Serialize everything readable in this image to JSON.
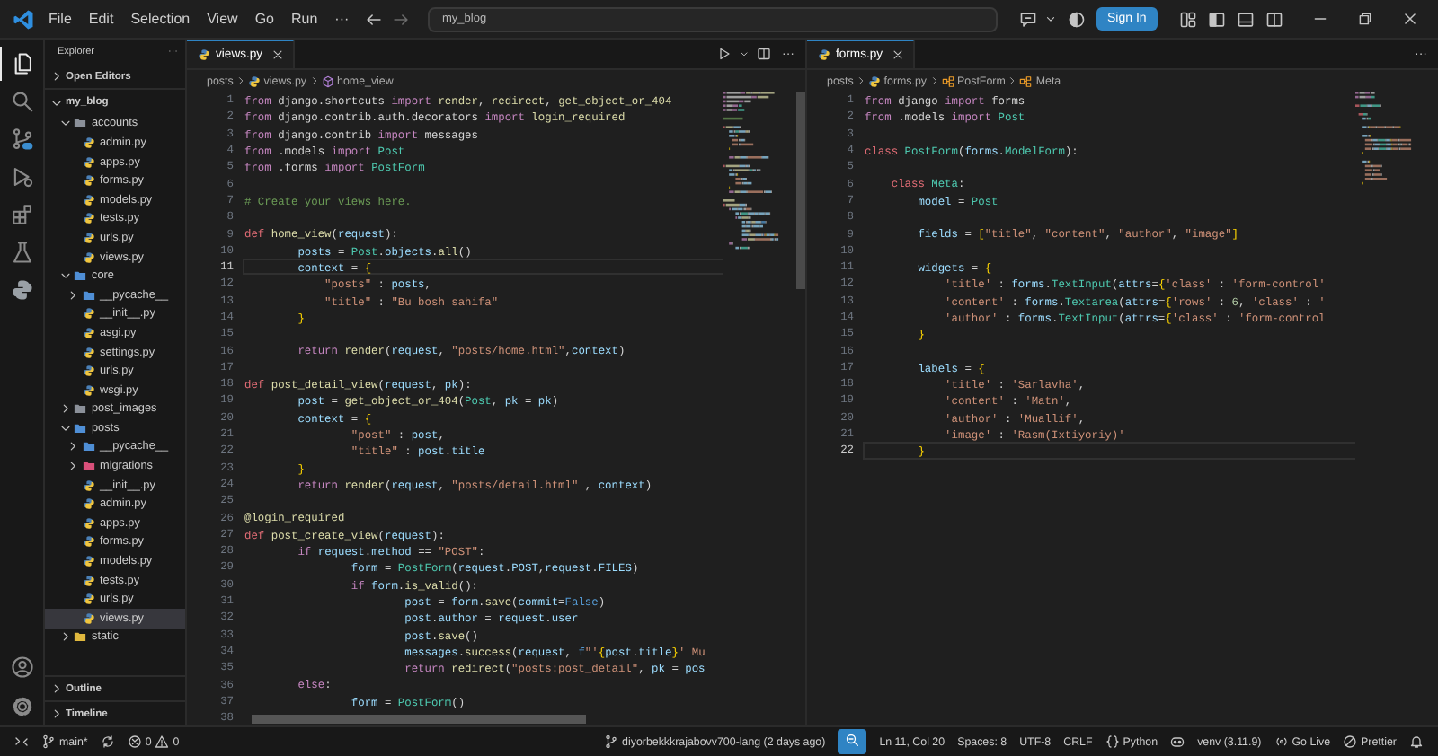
{
  "title_bar": {
    "menus": [
      "File",
      "Edit",
      "Selection",
      "View",
      "Go",
      "Run",
      "···"
    ],
    "search": {
      "value": "my_blog"
    },
    "sign_in": "Sign In"
  },
  "activity_bar": {
    "items": [
      {
        "kind": "files",
        "selected": true
      },
      {
        "kind": "search",
        "selected": false
      },
      {
        "kind": "scm",
        "selected": false
      },
      {
        "kind": "debug",
        "selected": false
      },
      {
        "kind": "extensions",
        "selected": false
      },
      {
        "kind": "flask",
        "selected": false
      },
      {
        "kind": "python",
        "selected": false
      }
    ]
  },
  "sidebar": {
    "title": "Explorer",
    "more": "···",
    "sections": [
      {
        "label": "Open Editors",
        "expanded": false
      }
    ],
    "tree": {
      "label": "my_blog",
      "kind": "root",
      "expanded": true,
      "selected": false,
      "children": [
        {
          "label": "accounts",
          "kind": "folder",
          "color": "#8b9099",
          "expanded": true,
          "selected": false,
          "children": [
            {
              "label": "admin.py",
              "kind": "file",
              "selected": false
            },
            {
              "label": "apps.py",
              "kind": "file",
              "selected": false
            },
            {
              "label": "forms.py",
              "kind": "file",
              "selected": false
            },
            {
              "label": "models.py",
              "kind": "file",
              "selected": false
            },
            {
              "label": "tests.py",
              "kind": "file",
              "selected": false
            },
            {
              "label": "urls.py",
              "kind": "file",
              "selected": false
            },
            {
              "label": "views.py",
              "kind": "file",
              "selected": false
            }
          ]
        },
        {
          "label": "core",
          "kind": "folder",
          "color": "#4f8fd6",
          "expanded": true,
          "selected": false,
          "children": [
            {
              "label": "__pycache__",
              "kind": "folder",
              "color": "#4f8fd6",
              "expanded": false,
              "selected": false
            },
            {
              "label": "__init__.py",
              "kind": "file",
              "selected": false
            },
            {
              "label": "asgi.py",
              "kind": "file",
              "selected": false
            },
            {
              "label": "settings.py",
              "kind": "file",
              "selected": false
            },
            {
              "label": "urls.py",
              "kind": "file",
              "selected": false
            },
            {
              "label": "wsgi.py",
              "kind": "file",
              "selected": false
            }
          ]
        },
        {
          "label": "post_images",
          "kind": "folder",
          "color": "#8b9099",
          "expanded": false,
          "selected": false
        },
        {
          "label": "posts",
          "kind": "folder",
          "color": "#4f8fd6",
          "expanded": true,
          "selected": false,
          "children": [
            {
              "label": "__pycache__",
              "kind": "folder",
              "color": "#4f8fd6",
              "expanded": false,
              "selected": false
            },
            {
              "label": "migrations",
              "kind": "folder",
              "color": "#d9507a",
              "expanded": false,
              "selected": false
            },
            {
              "label": "__init__.py",
              "kind": "file",
              "selected": false
            },
            {
              "label": "admin.py",
              "kind": "file",
              "selected": false
            },
            {
              "label": "apps.py",
              "kind": "file",
              "selected": false
            },
            {
              "label": "forms.py",
              "kind": "file",
              "selected": false
            },
            {
              "label": "models.py",
              "kind": "file",
              "selected": false
            },
            {
              "label": "tests.py",
              "kind": "file",
              "selected": false
            },
            {
              "label": "urls.py",
              "kind": "file",
              "selected": false
            },
            {
              "label": "views.py",
              "kind": "file",
              "selected": true
            }
          ]
        },
        {
          "label": "static",
          "kind": "folder",
          "color": "#e0b83e",
          "expanded": false,
          "selected": false
        }
      ]
    },
    "bottom_sections": [
      {
        "label": "Outline",
        "expanded": false
      },
      {
        "label": "Timeline",
        "expanded": false
      }
    ]
  },
  "editors": [
    {
      "tab": {
        "label": "views.py",
        "selected": true
      },
      "actions": [
        {
          "kind": "run"
        },
        {
          "kind": "split"
        }
      ],
      "more": "···",
      "breadcrumb": [
        {
          "label": "posts",
          "kind": "folder"
        },
        {
          "label": "views.py",
          "kind": "file"
        },
        {
          "label": "home_view",
          "kind": "function"
        }
      ],
      "lines": [
        {
          "n": "1",
          "current": false,
          "code": [
            {
              "kind": "kw",
              "text": "from"
            },
            {
              "kind": "plain",
              "text": " django.shortcuts "
            },
            {
              "kind": "kw",
              "text": "import"
            },
            {
              "kind": "fn",
              "text": " render"
            },
            {
              "kind": "plain",
              "text": ", "
            },
            {
              "kind": "fn",
              "text": "redirect"
            },
            {
              "kind": "plain",
              "text": ", "
            },
            {
              "kind": "fn",
              "text": "get_object_or_404"
            }
          ]
        },
        {
          "n": "2",
          "current": false,
          "code": [
            {
              "kind": "kw",
              "text": "from"
            },
            {
              "kind": "plain",
              "text": " django.contrib.auth.decorators "
            },
            {
              "kind": "kw",
              "text": "import"
            },
            {
              "kind": "fn",
              "text": " login_required"
            }
          ]
        },
        {
          "n": "3",
          "current": false,
          "code": [
            {
              "kind": "kw",
              "text": "from"
            },
            {
              "kind": "plain",
              "text": " django.contrib "
            },
            {
              "kind": "kw",
              "text": "import"
            },
            {
              "kind": "plain",
              "text": " messages"
            }
          ]
        },
        {
          "n": "4",
          "current": false,
          "code": [
            {
              "kind": "kw",
              "text": "from"
            },
            {
              "kind": "plain",
              "text": " .models "
            },
            {
              "kind": "kw",
              "text": "import"
            },
            {
              "kind": "type",
              "text": " Post"
            }
          ]
        },
        {
          "n": "5",
          "current": false,
          "code": [
            {
              "kind": "kw",
              "text": "from"
            },
            {
              "kind": "plain",
              "text": " .forms "
            },
            {
              "kind": "kw",
              "text": "import"
            },
            {
              "kind": "type",
              "text": " PostForm"
            }
          ]
        },
        {
          "n": "6",
          "current": false
        },
        {
          "n": "7",
          "current": false,
          "code": [
            {
              "kind": "com",
              "text": "# Create your views here."
            }
          ]
        },
        {
          "n": "8",
          "current": false
        },
        {
          "n": "9",
          "current": false,
          "code": [
            {
              "kind": "def",
              "text": "def"
            },
            {
              "kind": "fn",
              "text": " home_view"
            },
            {
              "kind": "plain",
              "text": "("
            },
            {
              "kind": "var",
              "text": "request"
            },
            {
              "kind": "plain",
              "text": "):"
            }
          ]
        },
        {
          "n": "10",
          "current": false,
          "code": [
            {
              "kind": "var",
              "text": "        posts"
            },
            {
              "kind": "plain",
              "text": " = "
            },
            {
              "kind": "type",
              "text": "Post"
            },
            {
              "kind": "plain",
              "text": "."
            },
            {
              "kind": "var",
              "text": "objects"
            },
            {
              "kind": "plain",
              "text": "."
            },
            {
              "kind": "fn",
              "text": "all"
            },
            {
              "kind": "plain",
              "text": "()"
            }
          ]
        },
        {
          "n": "11",
          "current": true,
          "code": [
            {
              "kind": "var",
              "text": "        context"
            },
            {
              "kind": "plain",
              "text": " = "
            },
            {
              "kind": "brace",
              "text": "{"
            }
          ]
        },
        {
          "n": "12",
          "current": false,
          "code": [
            {
              "kind": "str",
              "text": "            \"posts\""
            },
            {
              "kind": "plain",
              "text": " : "
            },
            {
              "kind": "var",
              "text": "posts"
            },
            {
              "kind": "plain",
              "text": ","
            }
          ]
        },
        {
          "n": "13",
          "current": false,
          "code": [
            {
              "kind": "str",
              "text": "            \"title\""
            },
            {
              "kind": "plain",
              "text": " : "
            },
            {
              "kind": "str",
              "text": "\"Bu bosh sahifa\""
            }
          ]
        },
        {
          "n": "14",
          "current": false,
          "code": [
            {
              "kind": "brace",
              "text": "        }"
            }
          ]
        },
        {
          "n": "15",
          "current": false
        },
        {
          "n": "16",
          "current": false,
          "code": [
            {
              "kind": "kw",
              "text": "        return"
            },
            {
              "kind": "fn",
              "text": " render"
            },
            {
              "kind": "plain",
              "text": "("
            },
            {
              "kind": "var",
              "text": "request"
            },
            {
              "kind": "plain",
              "text": ", "
            },
            {
              "kind": "str",
              "text": "\"posts/home.html\""
            },
            {
              "kind": "plain",
              "text": ","
            },
            {
              "kind": "var",
              "text": "context"
            },
            {
              "kind": "plain",
              "text": ")"
            }
          ]
        },
        {
          "n": "17",
          "current": false
        },
        {
          "n": "18",
          "current": false,
          "code": [
            {
              "kind": "def",
              "text": "def"
            },
            {
              "kind": "fn",
              "text": " post_detail_view"
            },
            {
              "kind": "plain",
              "text": "("
            },
            {
              "kind": "var",
              "text": "request"
            },
            {
              "kind": "plain",
              "text": ", "
            },
            {
              "kind": "var",
              "text": "pk"
            },
            {
              "kind": "plain",
              "text": "):"
            }
          ]
        },
        {
          "n": "19",
          "current": false,
          "code": [
            {
              "kind": "var",
              "text": "        post"
            },
            {
              "kind": "plain",
              "text": " = "
            },
            {
              "kind": "fn",
              "text": "get_object_or_404"
            },
            {
              "kind": "plain",
              "text": "("
            },
            {
              "kind": "type",
              "text": "Post"
            },
            {
              "kind": "plain",
              "text": ", "
            },
            {
              "kind": "var",
              "text": "pk"
            },
            {
              "kind": "plain",
              "text": " = "
            },
            {
              "kind": "var",
              "text": "pk"
            },
            {
              "kind": "plain",
              "text": ")"
            }
          ]
        },
        {
          "n": "20",
          "current": false,
          "code": [
            {
              "kind": "var",
              "text": "        context"
            },
            {
              "kind": "plain",
              "text": " = "
            },
            {
              "kind": "brace",
              "text": "{"
            }
          ]
        },
        {
          "n": "21",
          "current": false,
          "code": [
            {
              "kind": "str",
              "text": "                \"post\""
            },
            {
              "kind": "plain",
              "text": " : "
            },
            {
              "kind": "var",
              "text": "post"
            },
            {
              "kind": "plain",
              "text": ","
            }
          ]
        },
        {
          "n": "22",
          "current": false,
          "code": [
            {
              "kind": "str",
              "text": "                \"title\""
            },
            {
              "kind": "plain",
              "text": " : "
            },
            {
              "kind": "var",
              "text": "post"
            },
            {
              "kind": "plain",
              "text": "."
            },
            {
              "kind": "var",
              "text": "title"
            }
          ]
        },
        {
          "n": "23",
          "current": false,
          "code": [
            {
              "kind": "brace",
              "text": "        }"
            }
          ]
        },
        {
          "n": "24",
          "current": false,
          "code": [
            {
              "kind": "kw",
              "text": "        return"
            },
            {
              "kind": "fn",
              "text": " render"
            },
            {
              "kind": "plain",
              "text": "("
            },
            {
              "kind": "var",
              "text": "request"
            },
            {
              "kind": "plain",
              "text": ", "
            },
            {
              "kind": "str",
              "text": "\"posts/detail.html\""
            },
            {
              "kind": "plain",
              "text": " , "
            },
            {
              "kind": "var",
              "text": "context"
            },
            {
              "kind": "plain",
              "text": ")"
            }
          ]
        },
        {
          "n": "25",
          "current": false
        },
        {
          "n": "26",
          "current": false,
          "code": [
            {
              "kind": "dec",
              "text": "@login_required"
            }
          ]
        },
        {
          "n": "27",
          "current": false,
          "code": [
            {
              "kind": "def",
              "text": "def"
            },
            {
              "kind": "fn",
              "text": " post_create_view"
            },
            {
              "kind": "plain",
              "text": "("
            },
            {
              "kind": "var",
              "text": "request"
            },
            {
              "kind": "plain",
              "text": "):"
            }
          ]
        },
        {
          "n": "28",
          "current": false,
          "code": [
            {
              "kind": "kw",
              "text": "        if"
            },
            {
              "kind": "var",
              "text": " request"
            },
            {
              "kind": "plain",
              "text": "."
            },
            {
              "kind": "var",
              "text": "method"
            },
            {
              "kind": "plain",
              "text": " == "
            },
            {
              "kind": "str",
              "text": "\"POST\""
            },
            {
              "kind": "plain",
              "text": ":"
            }
          ]
        },
        {
          "n": "29",
          "current": false,
          "code": [
            {
              "kind": "var",
              "text": "                form"
            },
            {
              "kind": "plain",
              "text": " = "
            },
            {
              "kind": "type",
              "text": "PostForm"
            },
            {
              "kind": "plain",
              "text": "("
            },
            {
              "kind": "var",
              "text": "request"
            },
            {
              "kind": "plain",
              "text": "."
            },
            {
              "kind": "var",
              "text": "POST"
            },
            {
              "kind": "plain",
              "text": ","
            },
            {
              "kind": "var",
              "text": "request"
            },
            {
              "kind": "plain",
              "text": "."
            },
            {
              "kind": "var",
              "text": "FILES"
            },
            {
              "kind": "plain",
              "text": ")"
            }
          ]
        },
        {
          "n": "30",
          "current": false,
          "code": [
            {
              "kind": "kw",
              "text": "                if"
            },
            {
              "kind": "var",
              "text": " form"
            },
            {
              "kind": "plain",
              "text": "."
            },
            {
              "kind": "fn",
              "text": "is_valid"
            },
            {
              "kind": "plain",
              "text": "():"
            }
          ]
        },
        {
          "n": "31",
          "current": false,
          "code": [
            {
              "kind": "var",
              "text": "                        post"
            },
            {
              "kind": "plain",
              "text": " = "
            },
            {
              "kind": "var",
              "text": "form"
            },
            {
              "kind": "plain",
              "text": "."
            },
            {
              "kind": "fn",
              "text": "save"
            },
            {
              "kind": "plain",
              "text": "("
            },
            {
              "kind": "var",
              "text": "commit"
            },
            {
              "kind": "plain",
              "text": "="
            },
            {
              "kind": "const",
              "text": "False"
            },
            {
              "kind": "plain",
              "text": ")"
            }
          ]
        },
        {
          "n": "32",
          "current": false,
          "code": [
            {
              "kind": "var",
              "text": "                        post"
            },
            {
              "kind": "plain",
              "text": "."
            },
            {
              "kind": "var",
              "text": "author"
            },
            {
              "kind": "plain",
              "text": " = "
            },
            {
              "kind": "var",
              "text": "request"
            },
            {
              "kind": "plain",
              "text": "."
            },
            {
              "kind": "var",
              "text": "user"
            }
          ]
        },
        {
          "n": "33",
          "current": false,
          "code": [
            {
              "kind": "var",
              "text": "                        post"
            },
            {
              "kind": "plain",
              "text": "."
            },
            {
              "kind": "fn",
              "text": "save"
            },
            {
              "kind": "plain",
              "text": "()"
            }
          ]
        },
        {
          "n": "34",
          "current": false,
          "code": [
            {
              "kind": "var",
              "text": "                        messages"
            },
            {
              "kind": "plain",
              "text": "."
            },
            {
              "kind": "fn",
              "text": "success"
            },
            {
              "kind": "plain",
              "text": "("
            },
            {
              "kind": "var",
              "text": "request"
            },
            {
              "kind": "plain",
              "text": ", "
            },
            {
              "kind": "const",
              "text": "f"
            },
            {
              "kind": "str",
              "text": "\"'"
            },
            {
              "kind": "brace",
              "text": "{"
            },
            {
              "kind": "var",
              "text": "post"
            },
            {
              "kind": "plain",
              "text": "."
            },
            {
              "kind": "var",
              "text": "title"
            },
            {
              "kind": "brace",
              "text": "}"
            },
            {
              "kind": "str",
              "text": "' Mu"
            }
          ]
        },
        {
          "n": "35",
          "current": false,
          "code": [
            {
              "kind": "kw",
              "text": "                        return"
            },
            {
              "kind": "fn",
              "text": " redirect"
            },
            {
              "kind": "plain",
              "text": "("
            },
            {
              "kind": "str",
              "text": "\"posts:post_detail\""
            },
            {
              "kind": "plain",
              "text": ", "
            },
            {
              "kind": "var",
              "text": "pk"
            },
            {
              "kind": "plain",
              "text": " = "
            },
            {
              "kind": "var",
              "text": "pos"
            }
          ]
        },
        {
          "n": "36",
          "current": false,
          "code": [
            {
              "kind": "kw",
              "text": "        else"
            },
            {
              "kind": "plain",
              "text": ":"
            }
          ]
        },
        {
          "n": "37",
          "current": false,
          "code": [
            {
              "kind": "var",
              "text": "                form"
            },
            {
              "kind": "plain",
              "text": " = "
            },
            {
              "kind": "type",
              "text": "PostForm"
            },
            {
              "kind": "plain",
              "text": "()"
            }
          ]
        },
        {
          "n": "38",
          "current": false
        }
      ]
    },
    {
      "tab": {
        "label": "forms.py",
        "selected": true
      },
      "more": "···",
      "breadcrumb": [
        {
          "label": "posts",
          "kind": "folder"
        },
        {
          "label": "forms.py",
          "kind": "file"
        },
        {
          "label": "PostForm",
          "kind": "class"
        },
        {
          "label": "Meta",
          "kind": "class"
        }
      ],
      "lines": [
        {
          "n": "1",
          "current": false,
          "code": [
            {
              "kind": "kw",
              "text": "from"
            },
            {
              "kind": "plain",
              "text": " django "
            },
            {
              "kind": "kw",
              "text": "import"
            },
            {
              "kind": "plain",
              "text": " forms"
            }
          ]
        },
        {
          "n": "2",
          "current": false,
          "code": [
            {
              "kind": "kw",
              "text": "from"
            },
            {
              "kind": "plain",
              "text": " .models "
            },
            {
              "kind": "kw",
              "text": "import"
            },
            {
              "kind": "type",
              "text": " Post"
            }
          ]
        },
        {
          "n": "3",
          "current": false
        },
        {
          "n": "4",
          "current": false,
          "code": [
            {
              "kind": "def",
              "text": "class"
            },
            {
              "kind": "type",
              "text": " PostForm"
            },
            {
              "kind": "plain",
              "text": "("
            },
            {
              "kind": "var",
              "text": "forms"
            },
            {
              "kind": "plain",
              "text": "."
            },
            {
              "kind": "type",
              "text": "ModelForm"
            },
            {
              "kind": "plain",
              "text": "):"
            }
          ]
        },
        {
          "n": "5",
          "current": false
        },
        {
          "n": "6",
          "current": false,
          "code": [
            {
              "kind": "def",
              "text": "    class"
            },
            {
              "kind": "type",
              "text": " Meta"
            },
            {
              "kind": "plain",
              "text": ":"
            }
          ]
        },
        {
          "n": "7",
          "current": false,
          "code": [
            {
              "kind": "var",
              "text": "        model"
            },
            {
              "kind": "plain",
              "text": " = "
            },
            {
              "kind": "type",
              "text": "Post"
            }
          ]
        },
        {
          "n": "8",
          "current": false
        },
        {
          "n": "9",
          "current": false,
          "code": [
            {
              "kind": "var",
              "text": "        fields"
            },
            {
              "kind": "plain",
              "text": " = "
            },
            {
              "kind": "brace",
              "text": "["
            },
            {
              "kind": "str",
              "text": "\"title\""
            },
            {
              "kind": "plain",
              "text": ", "
            },
            {
              "kind": "str",
              "text": "\"content\""
            },
            {
              "kind": "plain",
              "text": ", "
            },
            {
              "kind": "str",
              "text": "\"author\""
            },
            {
              "kind": "plain",
              "text": ", "
            },
            {
              "kind": "str",
              "text": "\"image\""
            },
            {
              "kind": "brace",
              "text": "]"
            }
          ]
        },
        {
          "n": "10",
          "current": false
        },
        {
          "n": "11",
          "current": false,
          "code": [
            {
              "kind": "var",
              "text": "        widgets"
            },
            {
              "kind": "plain",
              "text": " = "
            },
            {
              "kind": "brace",
              "text": "{"
            }
          ]
        },
        {
          "n": "12",
          "current": false,
          "code": [
            {
              "kind": "str",
              "text": "            'title'"
            },
            {
              "kind": "plain",
              "text": " : "
            },
            {
              "kind": "var",
              "text": "forms"
            },
            {
              "kind": "plain",
              "text": "."
            },
            {
              "kind": "type",
              "text": "TextInput"
            },
            {
              "kind": "plain",
              "text": "("
            },
            {
              "kind": "var",
              "text": "attrs"
            },
            {
              "kind": "plain",
              "text": "="
            },
            {
              "kind": "brace",
              "text": "{"
            },
            {
              "kind": "str",
              "text": "'class'"
            },
            {
              "kind": "plain",
              "text": " : "
            },
            {
              "kind": "str",
              "text": "'form-control'"
            }
          ]
        },
        {
          "n": "13",
          "current": false,
          "code": [
            {
              "kind": "str",
              "text": "            'content'"
            },
            {
              "kind": "plain",
              "text": " : "
            },
            {
              "kind": "var",
              "text": "forms"
            },
            {
              "kind": "plain",
              "text": "."
            },
            {
              "kind": "type",
              "text": "Textarea"
            },
            {
              "kind": "plain",
              "text": "("
            },
            {
              "kind": "var",
              "text": "attrs"
            },
            {
              "kind": "plain",
              "text": "="
            },
            {
              "kind": "brace",
              "text": "{"
            },
            {
              "kind": "str",
              "text": "'rows'"
            },
            {
              "kind": "plain",
              "text": " : "
            },
            {
              "kind": "num",
              "text": "6"
            },
            {
              "kind": "plain",
              "text": ", "
            },
            {
              "kind": "str",
              "text": "'class'"
            },
            {
              "kind": "plain",
              "text": " : "
            },
            {
              "kind": "str",
              "text": "'"
            }
          ]
        },
        {
          "n": "14",
          "current": false,
          "code": [
            {
              "kind": "str",
              "text": "            'author'"
            },
            {
              "kind": "plain",
              "text": " : "
            },
            {
              "kind": "var",
              "text": "forms"
            },
            {
              "kind": "plain",
              "text": "."
            },
            {
              "kind": "type",
              "text": "TextInput"
            },
            {
              "kind": "plain",
              "text": "("
            },
            {
              "kind": "var",
              "text": "attrs"
            },
            {
              "kind": "plain",
              "text": "="
            },
            {
              "kind": "brace",
              "text": "{"
            },
            {
              "kind": "str",
              "text": "'class'"
            },
            {
              "kind": "plain",
              "text": " : "
            },
            {
              "kind": "str",
              "text": "'form-control"
            }
          ]
        },
        {
          "n": "15",
          "current": false,
          "code": [
            {
              "kind": "brace",
              "text": "        }"
            }
          ]
        },
        {
          "n": "16",
          "current": false
        },
        {
          "n": "17",
          "current": false,
          "code": [
            {
              "kind": "var",
              "text": "        labels"
            },
            {
              "kind": "plain",
              "text": " = "
            },
            {
              "kind": "brace",
              "text": "{"
            }
          ]
        },
        {
          "n": "18",
          "current": false,
          "code": [
            {
              "kind": "str",
              "text": "            'title'"
            },
            {
              "kind": "plain",
              "text": " : "
            },
            {
              "kind": "str",
              "text": "'Sarlavha'"
            },
            {
              "kind": "plain",
              "text": ","
            }
          ]
        },
        {
          "n": "19",
          "current": false,
          "code": [
            {
              "kind": "str",
              "text": "            'content'"
            },
            {
              "kind": "plain",
              "text": " : "
            },
            {
              "kind": "str",
              "text": "'Matn'"
            },
            {
              "kind": "plain",
              "text": ","
            }
          ]
        },
        {
          "n": "20",
          "current": false,
          "code": [
            {
              "kind": "str",
              "text": "            'author'"
            },
            {
              "kind": "plain",
              "text": " : "
            },
            {
              "kind": "str",
              "text": "'Muallif'"
            },
            {
              "kind": "plain",
              "text": ","
            }
          ]
        },
        {
          "n": "21",
          "current": false,
          "code": [
            {
              "kind": "str",
              "text": "            'image'"
            },
            {
              "kind": "plain",
              "text": " : "
            },
            {
              "kind": "str",
              "text": "'Rasm(Ixtiyoriy)'"
            }
          ]
        },
        {
          "n": "22",
          "current": true,
          "code": [
            {
              "kind": "brace",
              "text": "        }"
            }
          ]
        }
      ]
    }
  ],
  "status_bar": {
    "left": [
      {
        "kind": "remote"
      },
      {
        "kind": "branch",
        "text": "main*"
      },
      {
        "kind": "sync"
      },
      {
        "kind": "problems",
        "errors": "0",
        "warnings": "0"
      }
    ],
    "right": [
      {
        "kind": "blame",
        "text": "diyorbekkkrajabovv700-lang (2 days ago)"
      },
      {
        "kind": "zoom",
        "selected": true
      },
      {
        "kind": "text",
        "text": "Ln 11, Col 20"
      },
      {
        "kind": "text",
        "text": "Spaces: 8"
      },
      {
        "kind": "text",
        "text": "UTF-8"
      },
      {
        "kind": "text",
        "text": "CRLF"
      },
      {
        "kind": "language",
        "text": "Python"
      },
      {
        "kind": "copilot"
      },
      {
        "kind": "text",
        "text": "venv (3.11.9)"
      },
      {
        "kind": "golive",
        "text": "Go Live"
      },
      {
        "kind": "prettier",
        "text": "Prettier"
      },
      {
        "kind": "bell"
      }
    ]
  }
}
